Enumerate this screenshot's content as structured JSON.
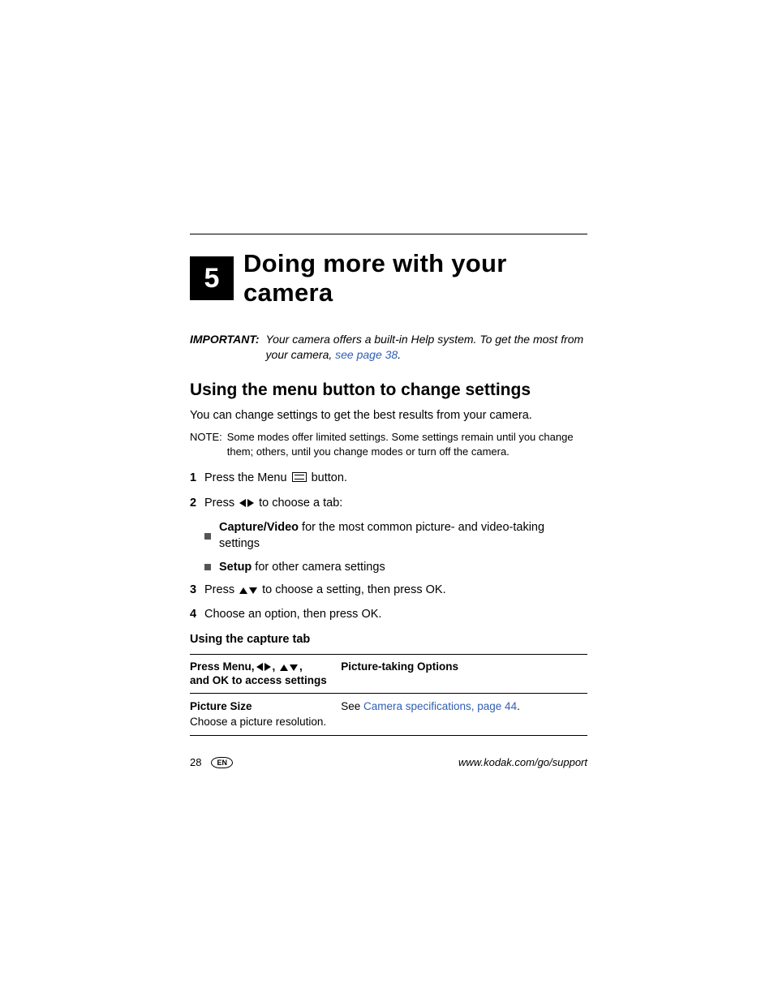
{
  "chapter": {
    "number": "5",
    "title": "Doing more with your camera"
  },
  "important": {
    "label": "IMPORTANT:",
    "text_before_link": "Your camera offers a built-in Help system. To get the most from your camera, ",
    "link": "see page 38",
    "text_after_link": "."
  },
  "section": {
    "title": "Using the menu button to change settings",
    "intro": "You can change settings to get the best results from your camera.",
    "note_label": "NOTE:",
    "note_text": "Some modes offer limited settings. Some settings remain until you change them; others, until you change modes or turn off the camera."
  },
  "steps": {
    "s1_num": "1",
    "s1_a": "Press the Menu ",
    "s1_b": " button.",
    "s2_num": "2",
    "s2_a": "Press ",
    "s2_b": " to choose a tab:",
    "s2_bullets": [
      {
        "bold": "Capture/Video",
        "rest": " for the most common picture- and video-taking settings"
      },
      {
        "bold": "Setup",
        "rest": " for other camera settings"
      }
    ],
    "s3_num": "3",
    "s3_a": "Press ",
    "s3_b": " to choose a setting, then press OK.",
    "s4_num": "4",
    "s4": "Choose an option, then press OK."
  },
  "subheading": "Using the capture tab",
  "table": {
    "h1a": "Press Menu,",
    "h1b": "and OK to access settings",
    "h2": "Picture-taking Options",
    "r1_title": "Picture Size",
    "r1_desc": "Choose a picture resolution.",
    "r1_see": "See ",
    "r1_link": "Camera specifications, page 44",
    "r1_after": "."
  },
  "footer": {
    "page": "28",
    "lang": "EN",
    "url": "www.kodak.com/go/support"
  }
}
